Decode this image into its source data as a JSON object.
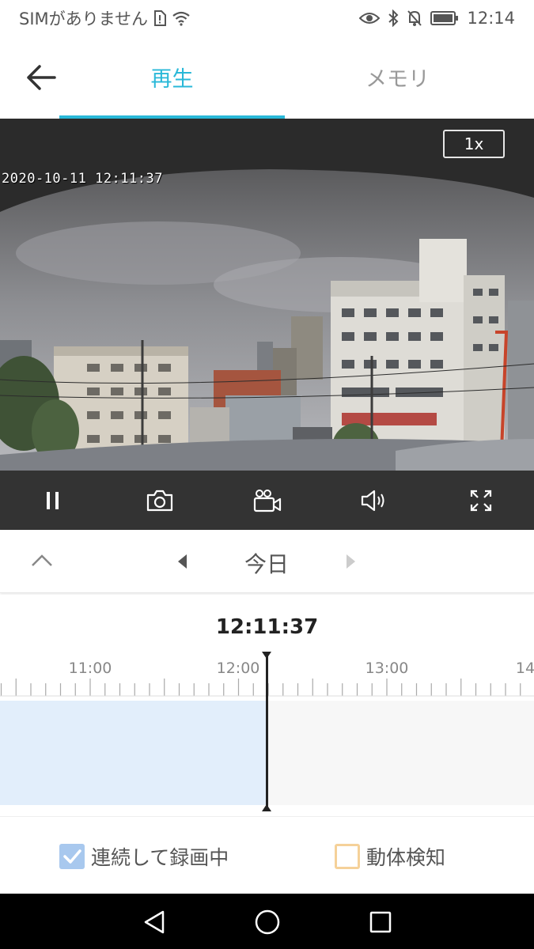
{
  "status_bar": {
    "carrier": "SIMがありません",
    "time": "12:14"
  },
  "header": {
    "back_icon": "arrow-left-icon",
    "tabs": [
      {
        "label": "再生",
        "active": true
      },
      {
        "label": "メモリ",
        "active": false
      }
    ]
  },
  "video": {
    "speed": "1x",
    "timestamp": "2020-10-11  12:11:37"
  },
  "controls": {
    "icons": [
      "pause-icon",
      "camera-icon",
      "video-record-icon",
      "speaker-icon",
      "fullscreen-icon"
    ]
  },
  "date_nav": {
    "date_label": "今日"
  },
  "timeline": {
    "current_time": "12:11:37",
    "tick_labels": [
      "11:00",
      "12:00",
      "13:00",
      "14"
    ],
    "recorded_until_fraction": 0.5
  },
  "legend": {
    "continuous_label": "連続して録画中",
    "continuous_checked": true,
    "motion_label": "動体検知",
    "motion_checked": false
  },
  "colors": {
    "accent": "#29b8d8",
    "recorded_fill": "#e2eefb",
    "continuous_box": "#a8c8ee",
    "motion_box": "#f5d199"
  }
}
